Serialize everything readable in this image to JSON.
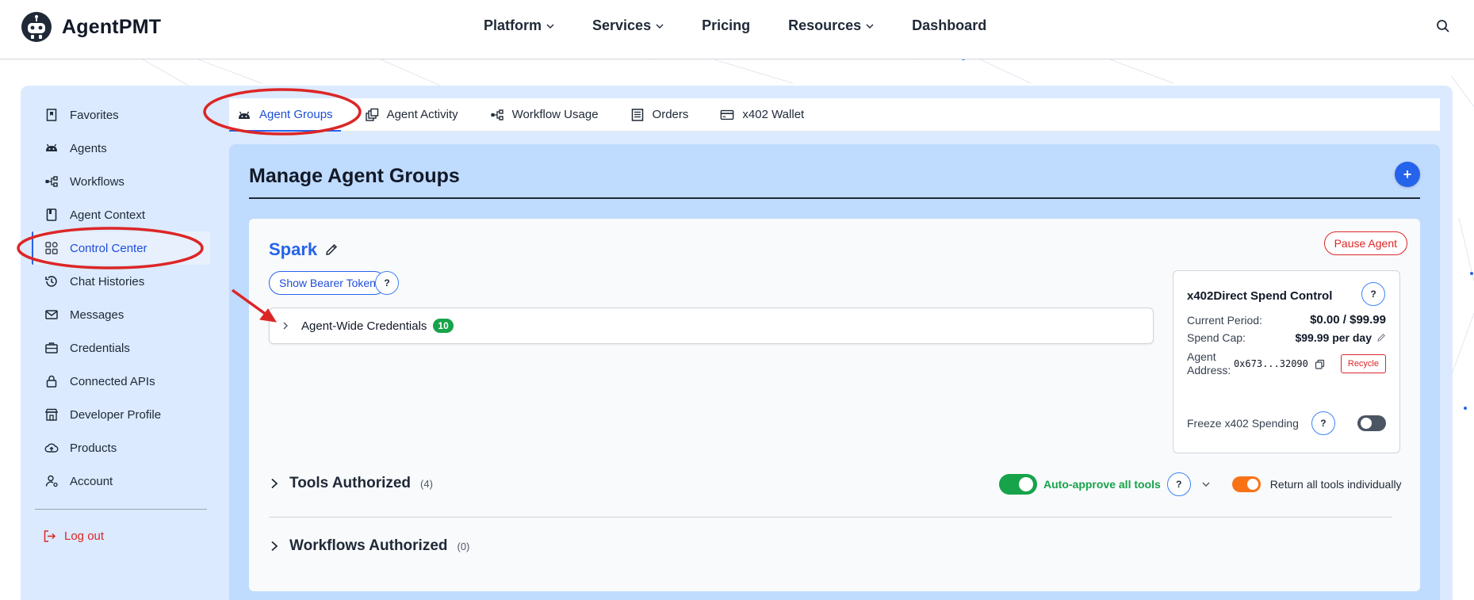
{
  "brand": {
    "name": "AgentPMT"
  },
  "nav": {
    "items": [
      {
        "label": "Platform",
        "dropdown": true
      },
      {
        "label": "Services",
        "dropdown": true
      },
      {
        "label": "Pricing",
        "dropdown": false
      },
      {
        "label": "Resources",
        "dropdown": true
      },
      {
        "label": "Dashboard",
        "dropdown": false
      }
    ],
    "search_icon": "search-icon"
  },
  "sidebar": {
    "items": [
      {
        "label": "Favorites",
        "icon": "bookmark-icon"
      },
      {
        "label": "Agents",
        "icon": "robot-icon"
      },
      {
        "label": "Workflows",
        "icon": "workflow-icon"
      },
      {
        "label": "Agent Context",
        "icon": "book-icon"
      },
      {
        "label": "Control Center",
        "icon": "grid-icon",
        "active": true
      },
      {
        "label": "Chat Histories",
        "icon": "history-icon"
      },
      {
        "label": "Messages",
        "icon": "mail-icon"
      },
      {
        "label": "Credentials",
        "icon": "briefcase-icon"
      },
      {
        "label": "Connected APIs",
        "icon": "lock-icon"
      },
      {
        "label": "Developer Profile",
        "icon": "store-icon"
      },
      {
        "label": "Products",
        "icon": "cloud-upload-icon"
      },
      {
        "label": "Account",
        "icon": "user-settings-icon"
      }
    ],
    "logout": "Log out"
  },
  "tabs": [
    {
      "label": "Agent Groups",
      "icon": "robot-icon",
      "active": true
    },
    {
      "label": "Agent Activity",
      "icon": "activity-icon"
    },
    {
      "label": "Workflow Usage",
      "icon": "workflow-icon"
    },
    {
      "label": "Orders",
      "icon": "orders-icon"
    },
    {
      "label": "x402 Wallet",
      "icon": "credit-card-icon"
    }
  ],
  "main": {
    "title": "Manage Agent Groups",
    "add_label": "+"
  },
  "agent": {
    "name": "Spark",
    "pause_label": "Pause Agent",
    "bearer_label": "Show Bearer Token",
    "help_label": "?",
    "credentials_label": "Agent-Wide Credentials",
    "credentials_count": "10"
  },
  "spend": {
    "title": "x402Direct Spend Control",
    "current_period_label": "Current Period:",
    "current_period_value": "$0.00 / $99.99",
    "spend_cap_label": "Spend Cap:",
    "spend_cap_value": "$99.99 per day",
    "address_label_1": "Agent",
    "address_label_2": "Address:",
    "address_value": "0x673...32090",
    "recycle_label": "Recycle",
    "freeze_label": "Freeze x402 Spending",
    "freeze_on": false
  },
  "tools": {
    "title": "Tools Authorized",
    "count": "(4)",
    "auto_approve_label": "Auto-approve all tools",
    "auto_approve_on": true,
    "return_label": "Return all tools individually",
    "return_on": true
  },
  "workflows": {
    "title": "Workflows Authorized",
    "count": "(0)"
  },
  "colors": {
    "accent": "#2563eb",
    "danger": "#dc2626",
    "success": "#16a34a",
    "orange": "#f97316",
    "panel": "#dbeafe",
    "main_panel": "#bfdbfe"
  }
}
